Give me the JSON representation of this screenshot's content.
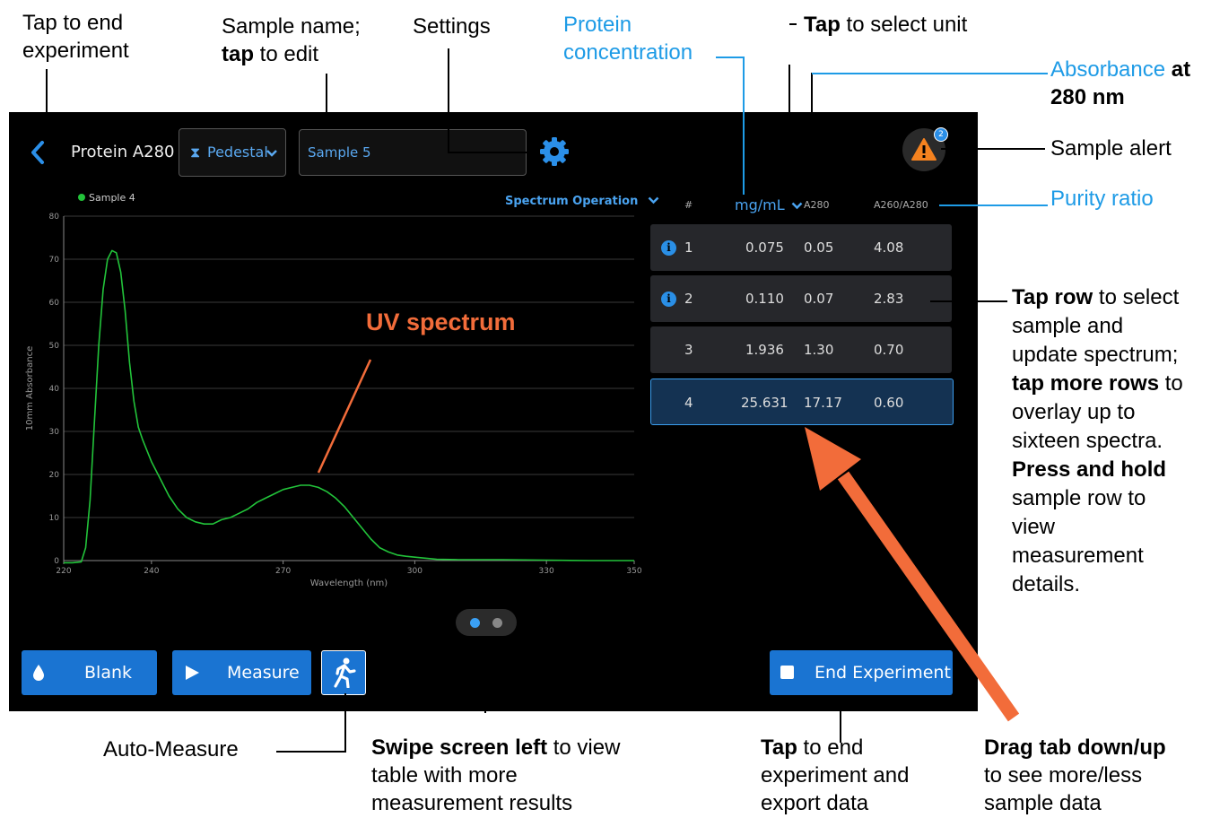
{
  "annotations": {
    "tap_end": [
      "Tap to end",
      "experiment"
    ],
    "sample_name_1": "Sample name;",
    "sample_name_tap": "tap",
    "sample_name_2": " to edit",
    "settings": "Settings",
    "protein_1": "Protein",
    "protein_2": "concentration",
    "select_unit_tap": "Tap",
    "select_unit_rest": " to select unit",
    "absorbance_blue": "Absorbance",
    "absorbance_at": " at",
    "absorbance_2": "280 nm",
    "sample_alert": "Sample alert",
    "purity_ratio": "Purity ratio",
    "tap_row_b": "Tap row",
    "tap_row_1": " to select",
    "tap_row_2": "sample and",
    "tap_row_3": "update spectrum;",
    "tap_more_b": "tap more rows",
    "tap_more_rest": " to",
    "overlay_1": "overlay up to",
    "overlay_2": "sixteen spectra.",
    "press_hold_b": "Press and hold",
    "press_1": "sample row to",
    "press_2": "view",
    "press_3": "measurement",
    "press_4": "details.",
    "uv_spectrum": "UV spectrum",
    "auto_measure": "Auto-Measure",
    "swipe_b": "Swipe screen left",
    "swipe_rest": " to view",
    "swipe_2": "table with more",
    "swipe_3": "measurement results",
    "tap_export_b": "Tap",
    "tap_export_rest": " to end",
    "tap_export_2": "experiment and",
    "tap_export_3": "export data",
    "drag_b": "Drag tab down/up",
    "drag_2": "to see more/less",
    "drag_3": "sample data"
  },
  "app": {
    "title": "Protein A280",
    "pedestal_label": "Pedestal",
    "sample_name_value": "Sample 5",
    "spectrum_operation": "Spectrum Operation",
    "alert_count": "2",
    "blank_label": "Blank",
    "measure_label": "Measure",
    "end_experiment_label": "End Experiment"
  },
  "table": {
    "headers": {
      "num": "#",
      "unit": "mg/mL",
      "a280": "A280",
      "ratio": "A260/A280"
    },
    "rows": [
      {
        "num": "1",
        "conc": "0.075",
        "a280": "0.05",
        "ratio": "4.08",
        "info": true
      },
      {
        "num": "2",
        "conc": "0.110",
        "a280": "0.07",
        "ratio": "2.83",
        "info": true
      },
      {
        "num": "3",
        "conc": "1.936",
        "a280": "1.30",
        "ratio": "0.70",
        "info": false
      },
      {
        "num": "4",
        "conc": "25.631",
        "a280": "17.17",
        "ratio": "0.60",
        "info": false,
        "selected": true
      }
    ]
  },
  "colors": {
    "accent": "#1a74d2",
    "series": "#22c33a",
    "annotation_blue": "#1e9be6",
    "arrow": "#f26c3a",
    "alert": "#f5821f"
  },
  "chart_data": {
    "type": "line",
    "title": "",
    "legend": [
      "Sample 4"
    ],
    "xlabel": "Wavelength (nm)",
    "ylabel": "10mm Absorbance",
    "xlim": [
      220,
      350
    ],
    "ylim": [
      0,
      80
    ],
    "x_ticks": [
      "220",
      "240",
      "270",
      "300",
      "330",
      "350"
    ],
    "y_ticks": [
      "0",
      "10",
      "20",
      "30",
      "40",
      "50",
      "60",
      "70",
      "80"
    ],
    "series": [
      {
        "name": "Sample 4",
        "x": [
          220,
          222,
          224,
          225,
          226,
          227,
          228,
          229,
          230,
          231,
          232,
          233,
          234,
          235,
          236,
          237,
          238,
          240,
          242,
          244,
          246,
          248,
          250,
          252,
          254,
          256,
          258,
          260,
          262,
          264,
          266,
          268,
          270,
          272,
          274,
          276,
          278,
          280,
          282,
          284,
          286,
          288,
          290,
          292,
          294,
          296,
          298,
          300,
          305,
          310,
          320,
          330,
          340,
          350
        ],
        "y": [
          -0.5,
          -0.5,
          -0.3,
          3,
          14,
          32,
          50,
          63,
          70,
          72,
          71.5,
          67,
          58,
          46,
          37,
          31,
          28,
          23,
          19,
          15,
          12,
          10,
          9,
          8.5,
          8.5,
          9.5,
          10,
          11,
          12,
          13.5,
          14.5,
          15.5,
          16.5,
          17,
          17.5,
          17.5,
          17,
          16,
          14.5,
          12.5,
          10,
          7.5,
          5,
          3,
          2,
          1.3,
          1,
          0.8,
          0.3,
          0.2,
          0.2,
          0.1,
          0,
          0
        ]
      }
    ]
  }
}
